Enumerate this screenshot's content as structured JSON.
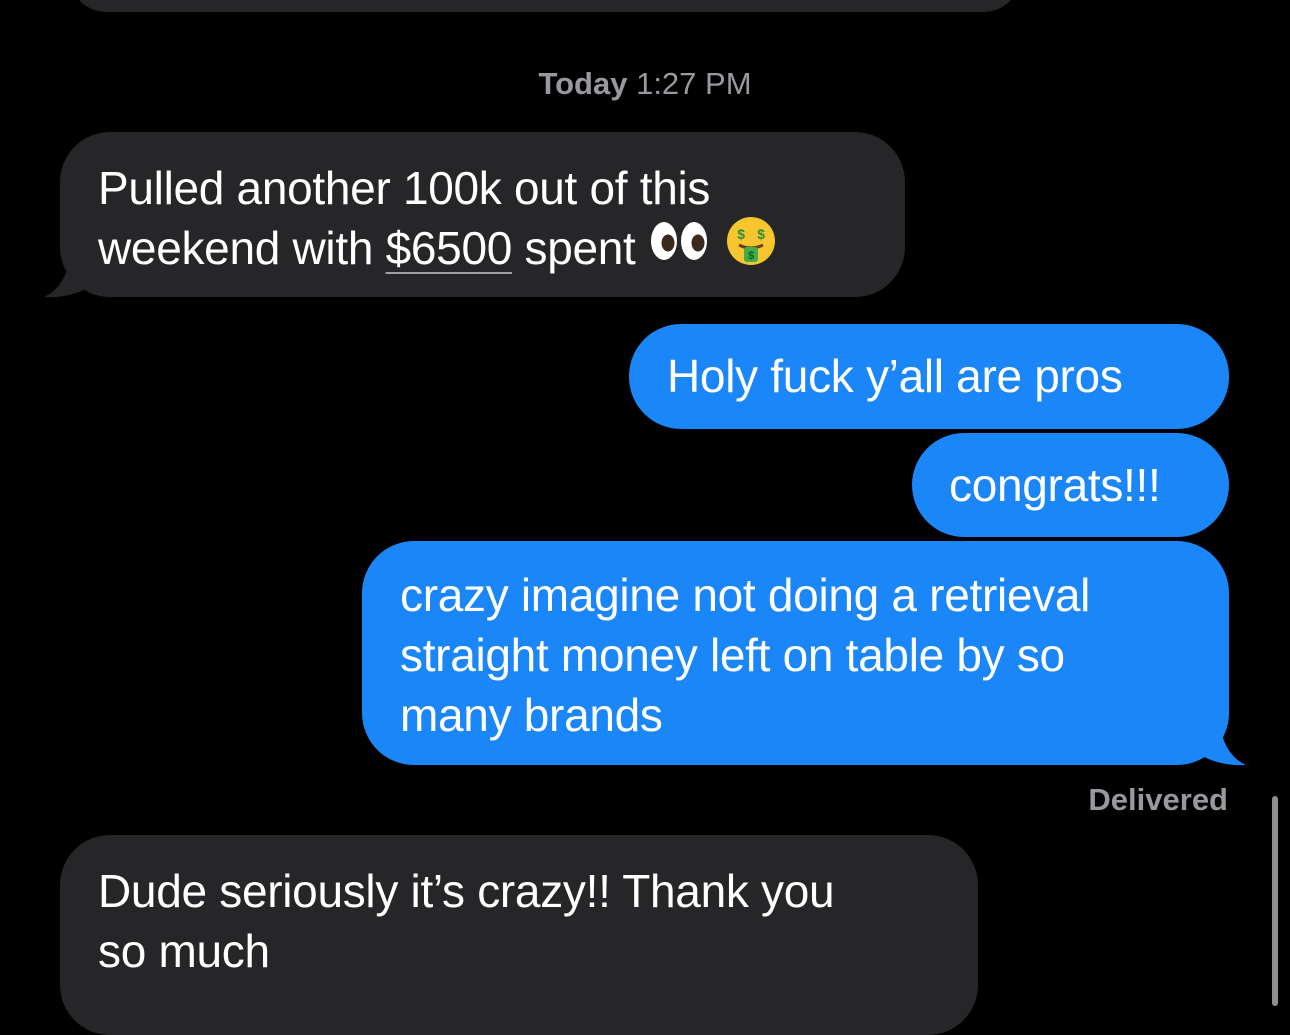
{
  "timestamp": {
    "day": "Today",
    "time": "1:27 PM"
  },
  "messages": [
    {
      "direction": "incoming",
      "lines": [
        "Pulled another 100k out of this",
        "weekend with "
      ],
      "underlined_amount": "$6500",
      "after_amount": " spent",
      "emojis": [
        "eyes-icon",
        "money-mouth-face-icon"
      ]
    },
    {
      "direction": "outgoing",
      "text": "Holy fuck y’all are pros"
    },
    {
      "direction": "outgoing",
      "text": "congrats!!!"
    },
    {
      "direction": "outgoing",
      "lines": [
        "crazy imagine not doing a retrieval",
        "straight money left on table by so",
        "many brands"
      ]
    },
    {
      "direction": "incoming",
      "lines": [
        "Dude seriously it’s crazy!! Thank you",
        "so much"
      ]
    }
  ],
  "status": {
    "delivered": "Delivered"
  },
  "colors": {
    "background": "#000000",
    "incoming_bubble": "#262628",
    "outgoing_bubble": "#1a86f7",
    "meta_text": "#98989e"
  }
}
